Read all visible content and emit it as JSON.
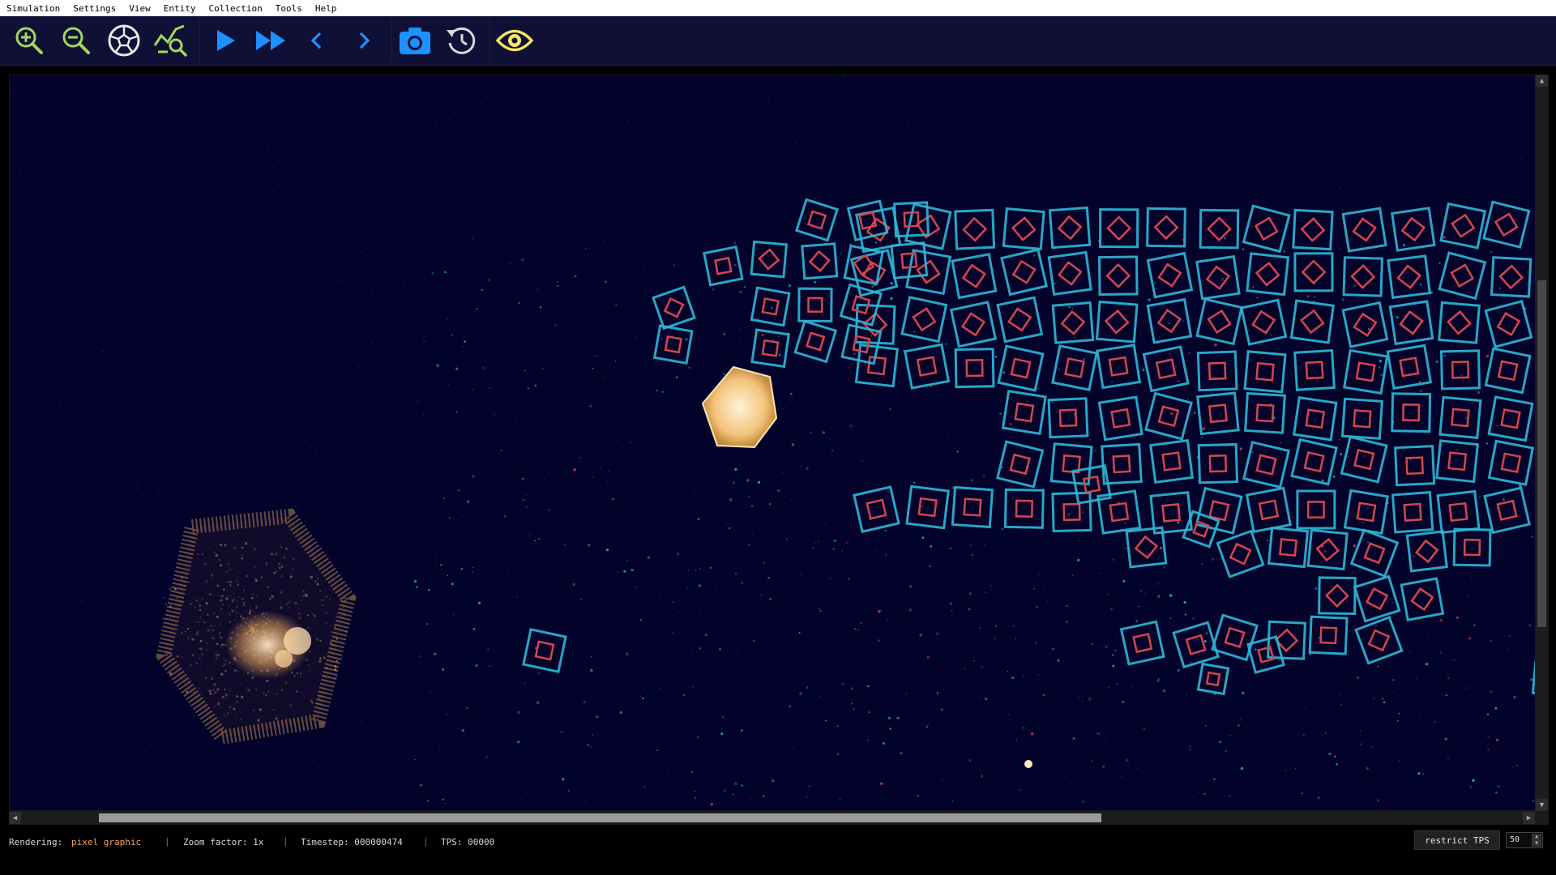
{
  "menu": {
    "items": [
      "Simulation",
      "Settings",
      "View",
      "Entity",
      "Collection",
      "Tools",
      "Help"
    ]
  },
  "toolbar": {
    "buttons": [
      {
        "icon": "zoom-in-icon",
        "color": "#a5d65a"
      },
      {
        "icon": "zoom-out-icon",
        "color": "#a5d65a"
      },
      {
        "icon": "continuous-zoom-icon",
        "color": "#e8e8e8"
      },
      {
        "icon": "search-zoom-icon",
        "color": "#a5d65a"
      },
      {
        "icon": "play-icon",
        "color": "#1e90ff"
      },
      {
        "icon": "fast-forward-icon",
        "color": "#1e90ff"
      },
      {
        "icon": "step-back-icon",
        "color": "#1e90ff"
      },
      {
        "icon": "step-forward-icon",
        "color": "#1e90ff"
      },
      {
        "icon": "snapshot-icon",
        "color": "#1e90ff"
      },
      {
        "icon": "restore-icon",
        "color": "#d8d8d8"
      },
      {
        "icon": "eye-icon",
        "color": "#f5e663"
      }
    ]
  },
  "colors": {
    "background": "#02022a",
    "cell_outline": "#2fb8d6",
    "cell_core": "#d6454d",
    "energy_particle": "#f3c27a"
  },
  "statusbar": {
    "rendering_label": "Rendering:",
    "rendering_value": "pixel graphic",
    "zoom_label": "Zoom factor: 1x",
    "timestep_label": "Timestep: 000000474",
    "tps_label": "TPS: 00000",
    "separator": "|",
    "restrict_tps_label": "restrict TPS",
    "tps_limit_value": "50"
  }
}
